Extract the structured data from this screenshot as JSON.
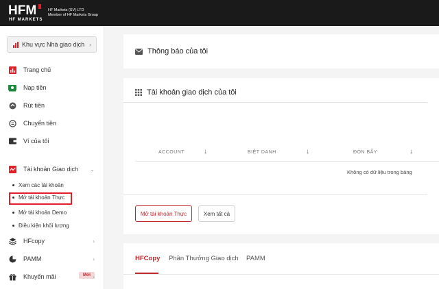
{
  "header": {
    "logo_text": "HFM",
    "logo_sub": "HF MARKETS",
    "company_line1": "HF Markets (SV) LTD",
    "company_line2": "Member of HF Markets Group"
  },
  "sidebar": {
    "area_button": "Khu vực Nhà giao dịch",
    "items": [
      {
        "label": "Trang chủ",
        "icon": "chart-icon"
      },
      {
        "label": "Nạp tiền",
        "icon": "deposit-icon"
      },
      {
        "label": "Rút tiền",
        "icon": "withdraw-icon"
      },
      {
        "label": "Chuyển tiền",
        "icon": "transfer-icon"
      },
      {
        "label": "Ví của tôi",
        "icon": "wallet-icon"
      }
    ],
    "trading_accounts": {
      "label": "Tài khoản Giao dịch",
      "sub_items": [
        "Xem các tài khoản",
        "Mở tài khoản Thực",
        "Mở tài khoản Demo",
        "Điều kiện khối lượng"
      ]
    },
    "lower_items": [
      {
        "label": "HFcopy"
      },
      {
        "label": "PAMM"
      },
      {
        "label": "Khuyến mãi",
        "badge": "Mới"
      }
    ]
  },
  "notifications": {
    "title": "Thông báo của tôi"
  },
  "accounts": {
    "title": "Tài khoản giao dịch của tôi",
    "columns": [
      "ACCOUNT",
      "BIỆT DANH",
      "ĐÒN BẨY"
    ],
    "empty_message": "Không có dữ liệu trong bảng",
    "open_live_button": "Mở tài khoản Thực",
    "view_all_button": "Xem tất cả"
  },
  "tabs": [
    "HFCopy",
    "Phần Thưởng Giao dịch",
    "PAMM"
  ],
  "colors": {
    "accent": "#c0282d",
    "brand_red": "#e01f26",
    "topbar": "#1a1a1a"
  }
}
